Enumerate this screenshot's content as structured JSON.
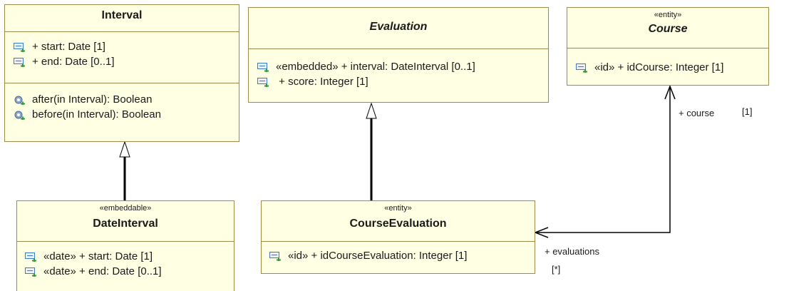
{
  "classes": {
    "interval": {
      "name": "Interval",
      "attributes": [
        "+ start: Date [1]",
        "+ end: Date [0..1]"
      ],
      "operations": [
        "after(in Interval): Boolean",
        "before(in Interval): Boolean"
      ]
    },
    "evaluation": {
      "name": "Evaluation",
      "attributes": [
        "«embedded» + interval: DateInterval [0..1]",
        " + score: Integer [1]"
      ]
    },
    "course": {
      "stereotype": "«entity»",
      "name": "Course",
      "attributes": [
        "«id» + idCourse: Integer [1]"
      ]
    },
    "date_interval": {
      "stereotype": "«embeddable»",
      "name": "DateInterval",
      "attributes": [
        "«date» + start: Date [1]",
        "«date» + end: Date [0..1]"
      ]
    },
    "course_evaluation": {
      "stereotype": "«entity»",
      "name": "CourseEvaluation",
      "attributes": [
        "«id» + idCourseEvaluation: Integer [1]"
      ]
    }
  },
  "association": {
    "course_role": "+ course",
    "course_mult": "[1]",
    "evaluations_role": "+ evaluations",
    "evaluations_mult": "[*]"
  },
  "icons": {
    "attribute": "attribute-icon",
    "operation": "operation-icon"
  },
  "colors": {
    "class_fill": "#ffffe3",
    "class_border": "#a08a4a",
    "attribute_icon": "#3b7bbf",
    "operation_icon": "#4a6a9a"
  }
}
